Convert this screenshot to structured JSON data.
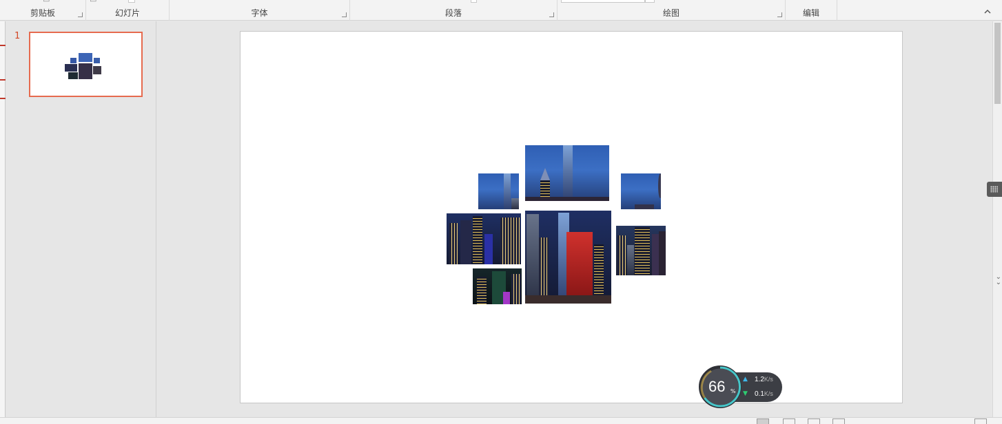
{
  "ribbon": {
    "groups": [
      {
        "id": "clipboard",
        "label": "剪贴板"
      },
      {
        "id": "slides",
        "label": "幻灯片"
      },
      {
        "id": "font",
        "label": "字体"
      },
      {
        "id": "paragraph",
        "label": "段落"
      },
      {
        "id": "drawing",
        "label": "绘图"
      },
      {
        "id": "editing",
        "label": "编辑"
      }
    ]
  },
  "thumbnails": [
    {
      "number": "1",
      "selected": true
    }
  ],
  "net_widget": {
    "percent": "66",
    "percent_sign": "%",
    "upload_value": "1.2",
    "upload_unit": "K/s",
    "download_value": "0.1",
    "download_unit": "K/s"
  },
  "colors": {
    "accent": "#e66a4e",
    "thumb_number": "#d24726",
    "upload_arrow": "#3fb7e8",
    "download_arrow": "#2ecc71",
    "gauge_ring": "#46c6c9",
    "gauge_ring_low": "#e8c04a"
  },
  "icons": {
    "collapse": "chevron-up-icon",
    "dialog_launcher": "launcher-icon",
    "upload": "arrow-up-icon",
    "download": "arrow-down-icon"
  }
}
